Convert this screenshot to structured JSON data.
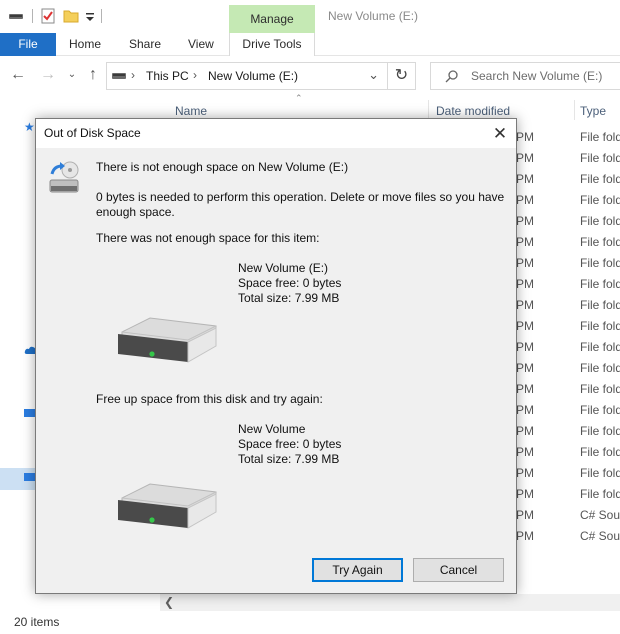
{
  "window": {
    "title": "New Volume (E:)",
    "manage_tab": "Manage"
  },
  "ribbon": {
    "tabs": [
      "File",
      "Home",
      "Share",
      "View",
      "Drive Tools"
    ]
  },
  "address": {
    "crumbs": [
      "This PC",
      "New Volume (E:)"
    ],
    "search_placeholder": "Search New Volume (E:)"
  },
  "columns": {
    "name": "Name",
    "date_modified": "Date modified",
    "type": "Type"
  },
  "rows": [
    {
      "time": "PM",
      "type": "File folder"
    },
    {
      "time": "PM",
      "type": "File folder"
    },
    {
      "time": "PM",
      "type": "File folder"
    },
    {
      "time": "PM",
      "type": "File folder"
    },
    {
      "time": "PM",
      "type": "File folder"
    },
    {
      "time": "PM",
      "type": "File folder"
    },
    {
      "time": "PM",
      "type": "File folder"
    },
    {
      "time": "PM",
      "type": "File folder"
    },
    {
      "time": "PM",
      "type": "File folder"
    },
    {
      "time": "PM",
      "type": "File folder"
    },
    {
      "time": "PM",
      "type": "File folder"
    },
    {
      "time": "PM",
      "type": "File folder"
    },
    {
      "time": "PM",
      "type": "File folder"
    },
    {
      "time": "PM",
      "type": "File folder"
    },
    {
      "time": "PM",
      "type": "File folder"
    },
    {
      "time": "PM",
      "type": "File folder"
    },
    {
      "time": "PM",
      "type": "File folder"
    },
    {
      "time": "PM",
      "type": "File folder"
    },
    {
      "time": "PM",
      "type": "C# Source"
    },
    {
      "time": "PM",
      "type": "C# Source"
    }
  ],
  "status": {
    "items": "20 items"
  },
  "dialog": {
    "title": "Out of Disk Space",
    "heading": "There is not enough space on New Volume (E:)",
    "message": "0 bytes is needed to perform this operation. Delete or move files so you have enough space.",
    "item_label": "There was not enough space for this item:",
    "drive1": {
      "name": "New Volume (E:)",
      "free": "Space free: 0 bytes",
      "total": "Total size: 7.99 MB"
    },
    "free_up_label": "Free up space from this disk and try again:",
    "drive2": {
      "name": "New Volume",
      "free": "Space free: 0 bytes",
      "total": "Total size: 7.99 MB"
    },
    "try_again": "Try Again",
    "cancel": "Cancel"
  },
  "colors": {
    "file_tab": "#1f6fc6",
    "manage_tab": "#c5e9b4",
    "default_button_border": "#0078d7",
    "dialog_bg": "#f0f0f0"
  }
}
